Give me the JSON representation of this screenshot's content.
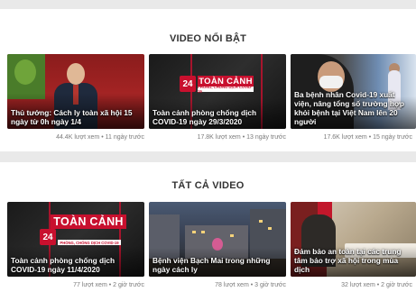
{
  "featured": {
    "title": "VIDEO NỔI BẬT",
    "videos": [
      {
        "caption": "Thủ tướng: Cách ly toàn xã hội 15 ngày từ 0h ngày 1/4",
        "meta": "44.4K lượt xem • 11 ngày trước"
      },
      {
        "caption": "Toàn cảnh phòng chống dịch COVID-19 ngày 29/3/2020",
        "meta": "17.8K lượt xem • 13 ngày trước"
      },
      {
        "caption": "Ba bệnh nhân Covid-19 xuất viện, nâng tổng số trường hợp khỏi bệnh tại Việt Nam lên 20 người",
        "meta": "17.6K lượt xem • 15 ngày trước"
      }
    ]
  },
  "all": {
    "title": "TẤT CẢ VIDEO",
    "videos": [
      {
        "caption": "Toàn cảnh phòng chống dịch COVID-19 ngày 11/4/2020",
        "meta": "77 lượt xem • 2 giờ trước"
      },
      {
        "caption": "Bệnh viện Bạch Mai trong những ngày cách ly",
        "meta": "78 lượt xem • 3 giờ trước"
      },
      {
        "caption": "Đảm bảo an toàn tại các trung tâm bảo trợ xã hội trong mùa dịch",
        "meta": "32 lượt xem • 2 giờ trước"
      }
    ]
  },
  "news_logo": {
    "badge": "24",
    "title": "TOÀN CẢNH",
    "subtitle": "PHÒNG, CHỐNG DỊCH COVID-19"
  },
  "colors": {
    "brand_red": "#c8102e",
    "background": "#e9e9e9",
    "panel": "#ffffff",
    "meta_text": "#7a7a7a"
  }
}
